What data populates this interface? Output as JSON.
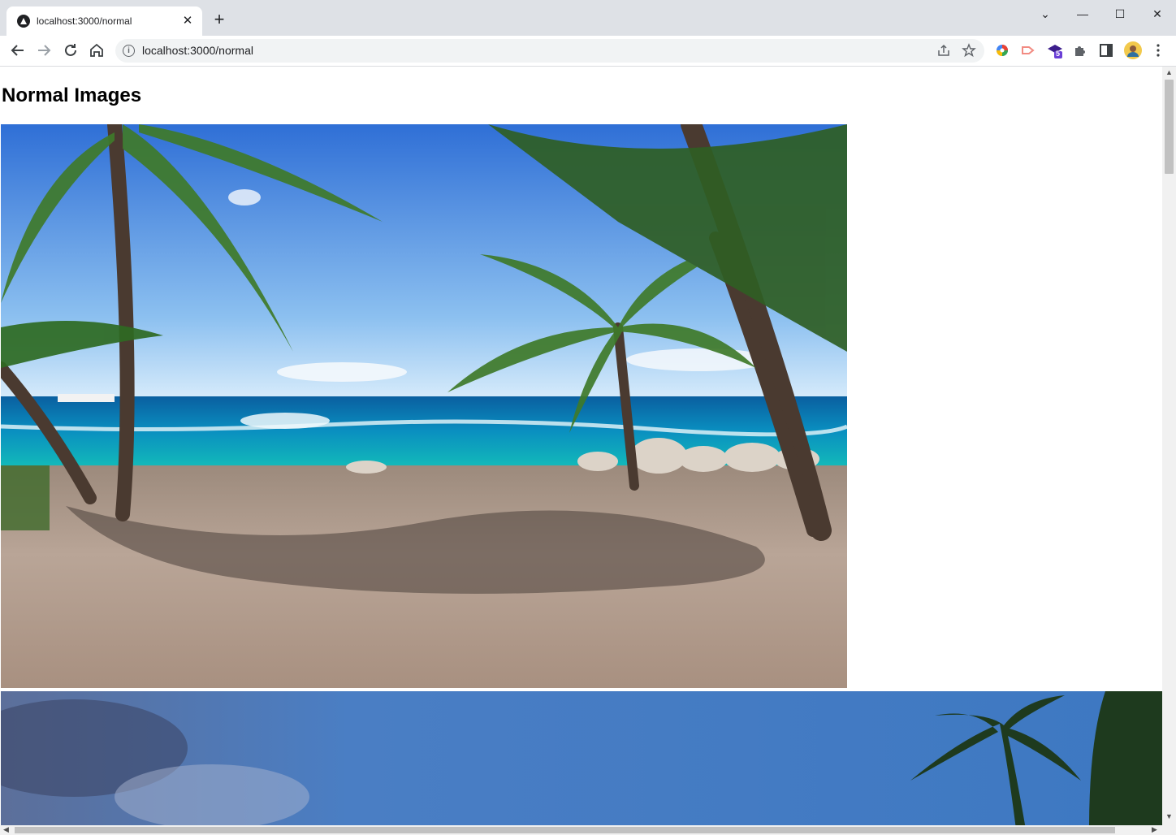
{
  "browser": {
    "tab_title": "localhost:3000/normal",
    "tab_close": "✕",
    "new_tab": "+",
    "url": "localhost:3000/normal",
    "extension_badge": "5",
    "window_controls": {
      "tab_search": "⌄",
      "minimize": "—",
      "maximize": "☐",
      "close": "✕"
    }
  },
  "page": {
    "heading": "Normal Images"
  },
  "colors": {
    "tabbar_bg": "#dee1e6",
    "sky_blue": "#4a86c8",
    "sea_turquoise": "#0aa6b0",
    "sand": "#b9a597"
  }
}
